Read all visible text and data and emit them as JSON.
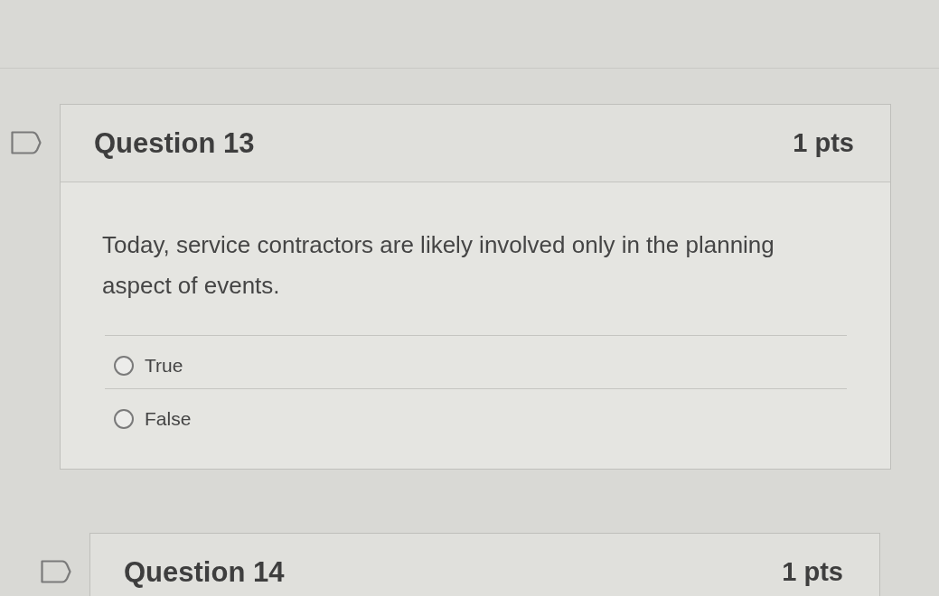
{
  "questions": [
    {
      "title": "Question 13",
      "points": "1 pts",
      "flagged": false,
      "text": "Today, service contractors are likely involved only in the planning aspect of events.",
      "answers": [
        {
          "label": "True",
          "selected": false
        },
        {
          "label": "False",
          "selected": false
        }
      ]
    },
    {
      "title": "Question 14",
      "points": "1 pts",
      "flagged": false
    }
  ]
}
